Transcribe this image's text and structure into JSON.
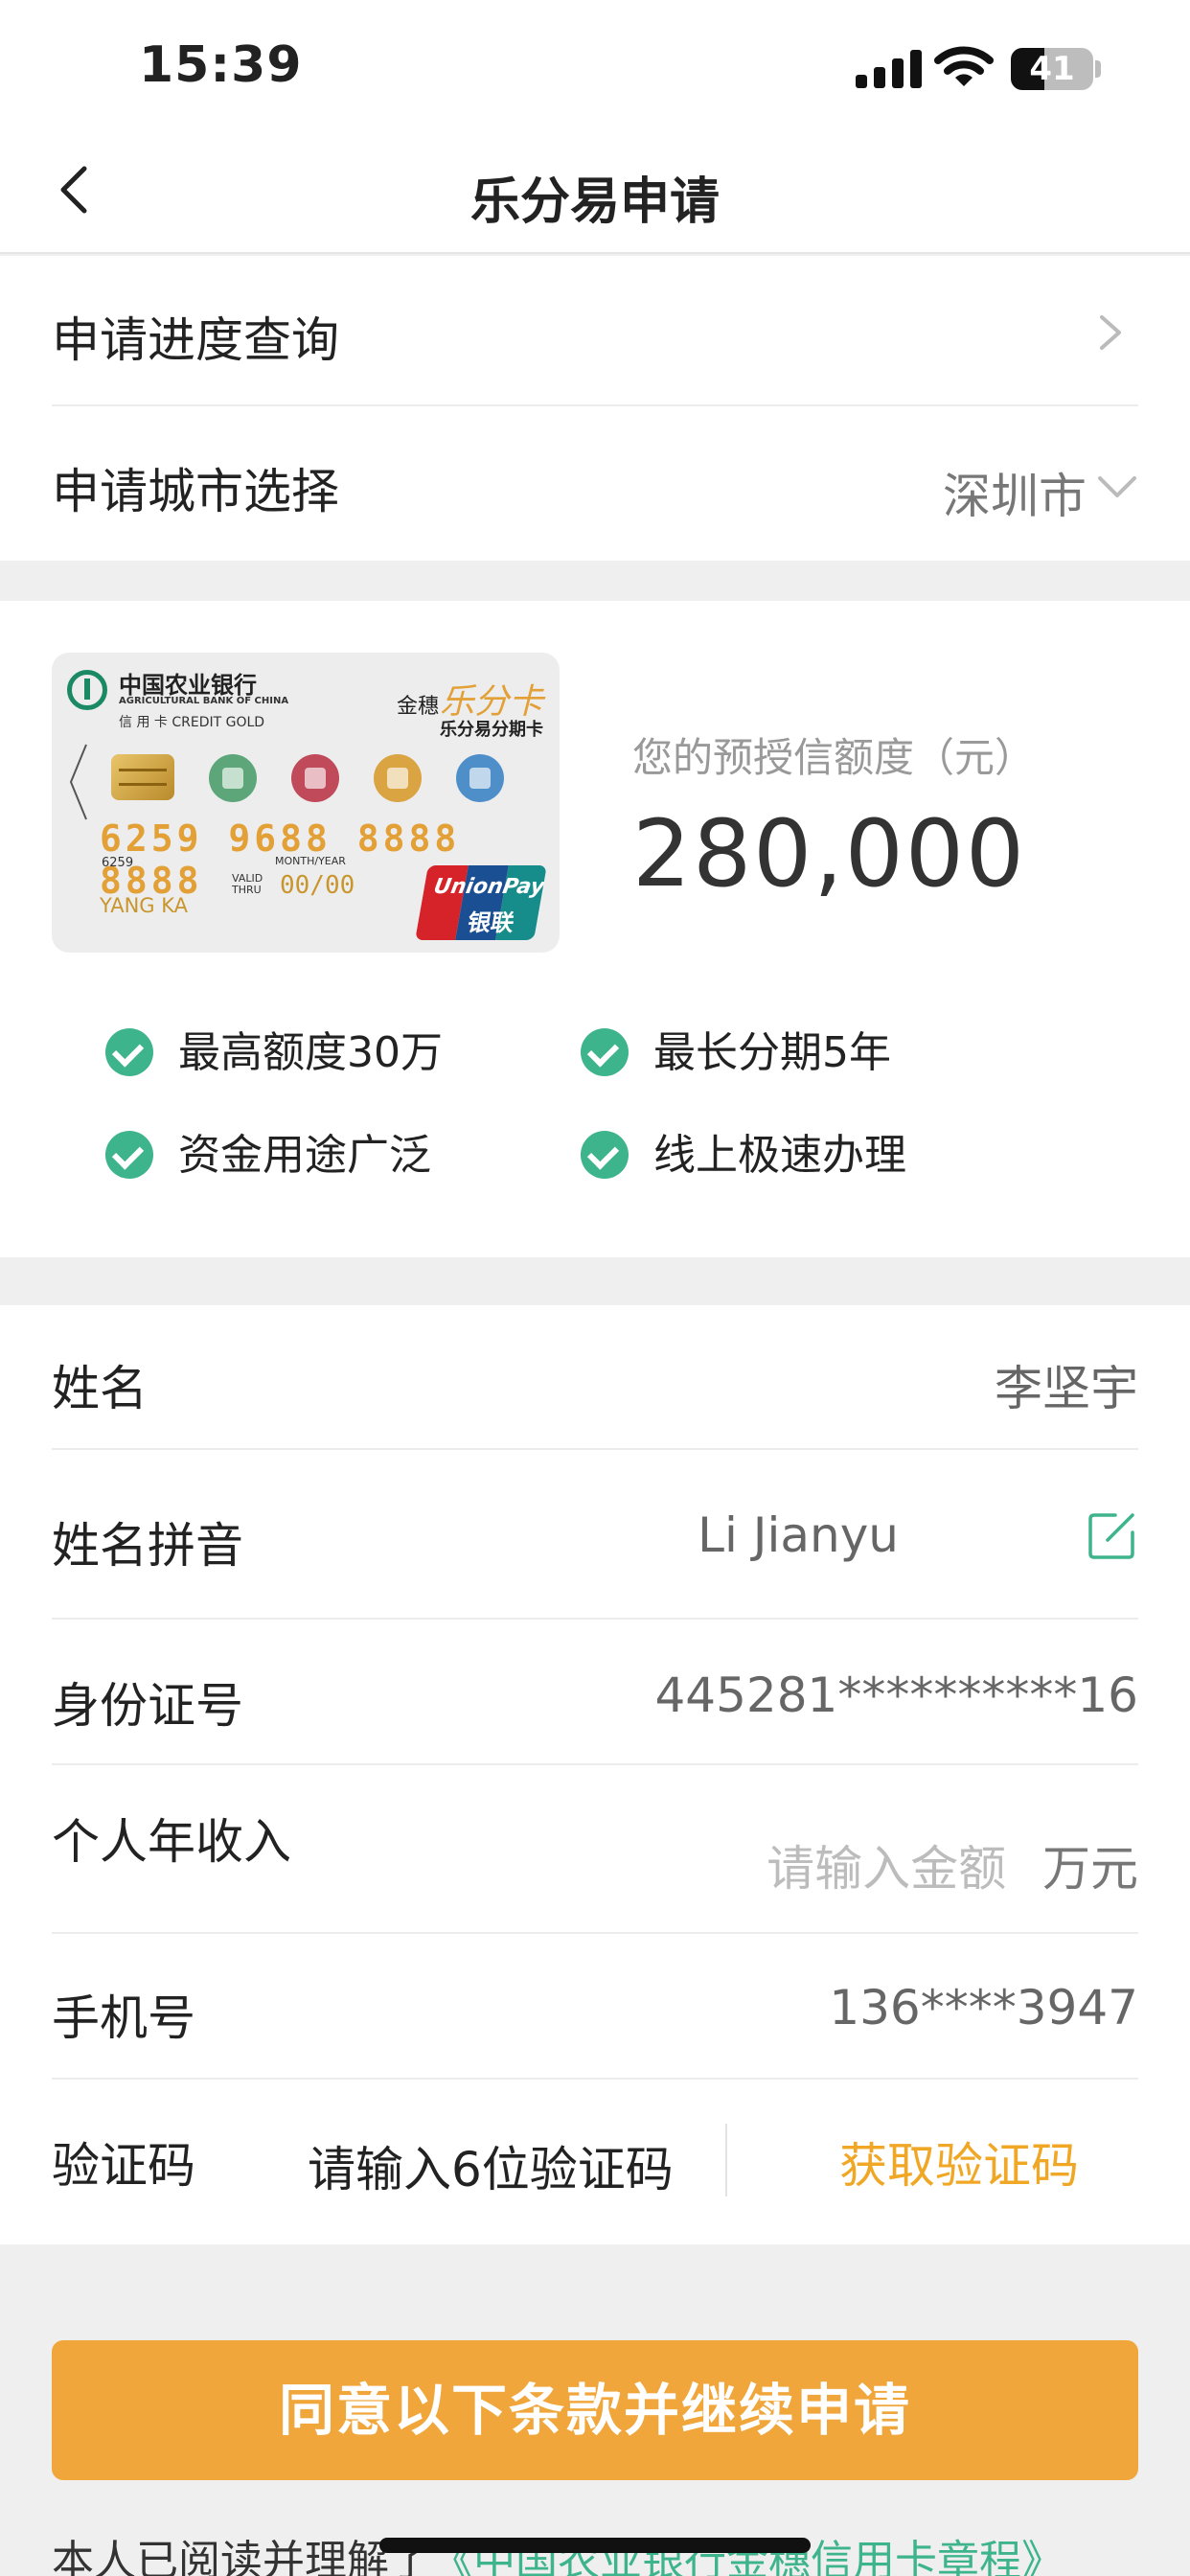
{
  "status_bar": {
    "time": "15:39",
    "battery": "41",
    "battery_level": 0.41
  },
  "nav": {
    "title": "乐分易申请"
  },
  "menu": {
    "progress_label": "申请进度查询",
    "city_label": "申请城市选择",
    "city_value": "深圳市"
  },
  "card": {
    "bank_name": "中国农业银行",
    "bank_name_en": "AGRICULTURAL BANK OF CHINA",
    "card_type": "信 用 卡  CREDIT GOLD",
    "brand_prefix": "金穗",
    "brand_name": "乐分卡",
    "brand_sub": "乐分易分期卡",
    "number": "6259 9688 8888 8888",
    "number_small": "6259",
    "month_year": "MONTH/YEAR",
    "valid_thru": "VALID\nTHRU",
    "expiry": "00/00",
    "holder": "YANG KA",
    "unionpay_en": "UnionPay",
    "unionpay_cn": "银联"
  },
  "credit": {
    "label": "您的预授信额度（元）",
    "amount": "280,000"
  },
  "features": [
    "最高额度30万",
    "最长分期5年",
    "资金用途广泛",
    "线上极速办理"
  ],
  "form": {
    "name_label": "姓名",
    "name_value": "李坚宇",
    "pinyin_label": "姓名拼音",
    "pinyin_value": "Li Jianyu",
    "id_label": "身份证号",
    "id_value": "445281**********16",
    "income_label": "个人年收入",
    "income_placeholder": "请输入金额",
    "income_unit": "万元",
    "phone_label": "手机号",
    "phone_value": "136****3947",
    "code_label": "验证码",
    "code_placeholder": "请输入6位验证码",
    "code_button": "获取验证码"
  },
  "submit_label": "同意以下条款并继续申请",
  "agreement": {
    "prefix": "本人已阅读并理解了",
    "link": "《中国农业银行金穗信用卡章程》"
  },
  "colors": {
    "accent": "#f0a63a",
    "green": "#3db48c",
    "link_orange": "#f0a726"
  }
}
